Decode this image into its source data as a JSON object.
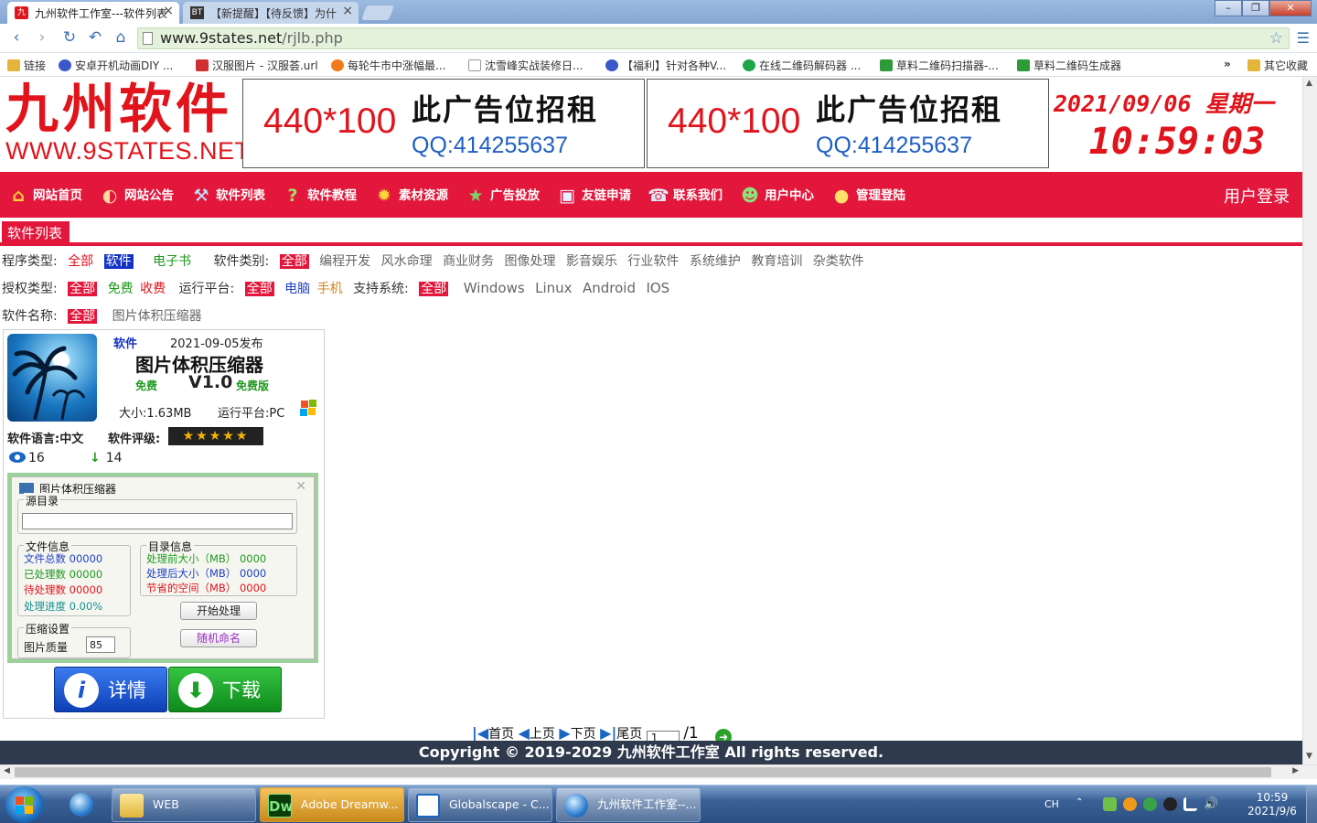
{
  "browser": {
    "tabs": [
      {
        "title": "九州软件工作室---软件列表",
        "favicon": "9states-icon"
      },
      {
        "title": "【新提醒】【待反馈】为什",
        "favicon": "bt-icon",
        "favicon_text": "BT"
      }
    ],
    "url_domain": "www.9states.net",
    "url_path": "/rjlb.php",
    "bookmarks": [
      "链接",
      "安卓开机动画DIY ...",
      "汉服图片 - 汉服荟.url",
      "每轮牛市中涨幅最...",
      "沈雪峰实战装修日...",
      "【福利】针对各种V...",
      "在线二维码解码器 ...",
      "草料二维码扫描器-...",
      "草料二维码生成器"
    ],
    "bookmarks_more": "»",
    "other_bookmarks": "其它收藏"
  },
  "header": {
    "logo_cn": "九州软件",
    "logo_en": "WWW.9STATES.NET",
    "ads": [
      {
        "size": "440*100",
        "title": "此广告位招租",
        "qq": "QQ:414255637"
      },
      {
        "size": "440*100",
        "title": "此广告位招租",
        "qq": "QQ:414255637"
      }
    ],
    "date": "2021/09/06 星期一",
    "time": "10:59:03"
  },
  "nav": {
    "items": [
      {
        "label": "网站首页",
        "icon": "home-icon"
      },
      {
        "label": "网站公告",
        "icon": "speaker-icon"
      },
      {
        "label": "软件列表",
        "icon": "software-icon"
      },
      {
        "label": "软件教程",
        "icon": "question-icon"
      },
      {
        "label": "素材资源",
        "icon": "sun-icon"
      },
      {
        "label": "广告投放",
        "icon": "star-icon"
      },
      {
        "label": "友链申请",
        "icon": "link-icon"
      },
      {
        "label": "联系我们",
        "icon": "phone-icon"
      },
      {
        "label": "用户中心",
        "icon": "users-icon"
      },
      {
        "label": "管理登陆",
        "icon": "admin-icon"
      }
    ],
    "user_login": "用户登录"
  },
  "section_title": "软件列表",
  "filters": {
    "program_type": {
      "label": "程序类型:",
      "options": [
        "全部",
        "软件",
        "电子书"
      ]
    },
    "software_category": {
      "label": "软件类别:",
      "options": [
        "全部",
        "编程开发",
        "风水命理",
        "商业财务",
        "图像处理",
        "影音娱乐",
        "行业软件",
        "系统维护",
        "教育培训",
        "杂类软件"
      ]
    },
    "license": {
      "label": "授权类型:",
      "options": [
        "全部",
        "免费",
        "收费"
      ]
    },
    "platform": {
      "label": "运行平台:",
      "options": [
        "全部",
        "电脑",
        "手机"
      ]
    },
    "system": {
      "label": "支持系统:",
      "options": [
        "全部",
        "Windows",
        "Linux",
        "Android",
        "IOS"
      ]
    },
    "software_name": {
      "label": "软件名称:",
      "options": [
        "全部",
        "图片体积压缩器"
      ]
    }
  },
  "card": {
    "category": "软件",
    "published": "2021-09-05发布",
    "name": "图片体积压缩器",
    "price": "免费",
    "version": "V1.0",
    "edition": "免费版",
    "size": "大小:1.63MB",
    "platform": "运行平台:PC",
    "language": "软件语言:中文",
    "rating_label": "软件评级:",
    "rating": 5,
    "rating_stars": "★★★★★",
    "views": "16",
    "downloads": "14",
    "detail_label": "详情",
    "download_label": "下载",
    "screenshot": {
      "window_title": "图片体积压缩器",
      "close": "✕",
      "source_dir": "源目录",
      "file_info": "文件信息",
      "file_lines": [
        "文件总数 00000",
        "已处理数 00000",
        "待处理数 00000",
        "处理进度 0.00%"
      ],
      "dir_info": "目录信息",
      "dir_lines": [
        "处理前大小（MB） 0000",
        "处理后大小（MB） 0000",
        "节省的空间（MB） 0000"
      ],
      "start_btn": "开始处理",
      "compress_settings": "压缩设置",
      "quality_label": "图片质量",
      "quality_value": "85",
      "random_btn": "随机命名"
    }
  },
  "pager": {
    "first": "首页",
    "prev": "上页",
    "next": "下页",
    "last": "尾页",
    "page_value": "1",
    "total": "/1"
  },
  "footer": "Copyright © 2019-2029 九州软件工作室 All rights reserved.",
  "taskbar": {
    "tasks": [
      {
        "label": "WEB",
        "icon": "folder-icon"
      },
      {
        "label": "Adobe Dreamw...",
        "icon": "dreamweaver-icon",
        "icon_text": "Dw"
      },
      {
        "label": "Globalscape - C...",
        "icon": "cuteftp-icon"
      },
      {
        "label": "九州软件工作室--...",
        "icon": "browser-icon"
      }
    ],
    "ime": "CH",
    "clock_time": "10:59",
    "clock_date": "2021/9/6"
  },
  "colors": {
    "brand_red": "#e3173b",
    "footer_bg": "#2f3a4d",
    "addr_bg": "#e4f2dc"
  }
}
